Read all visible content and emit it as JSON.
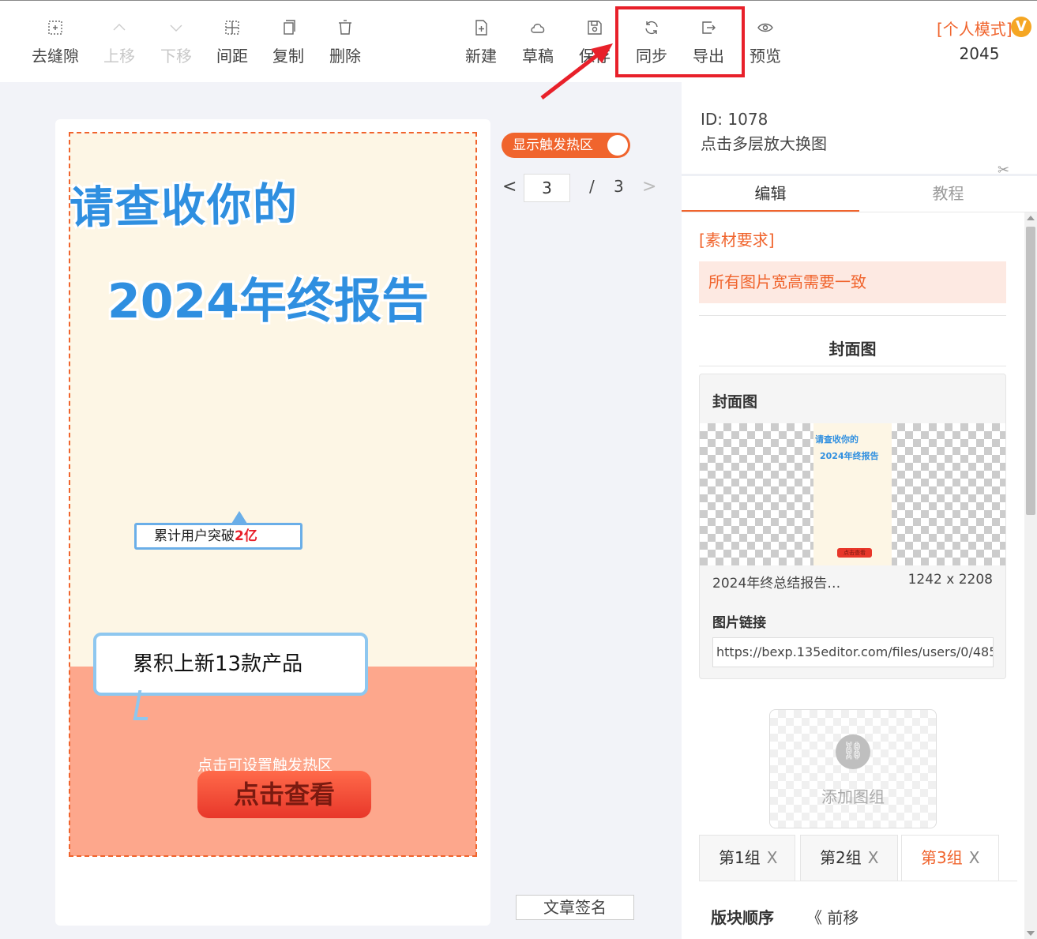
{
  "toolbar": {
    "items": [
      {
        "label": "去缝隙",
        "icon": "gap-icon",
        "enabled": true
      },
      {
        "label": "上移",
        "icon": "chevron-up-icon",
        "enabled": false
      },
      {
        "label": "下移",
        "icon": "chevron-down-icon",
        "enabled": false
      },
      {
        "label": "间距",
        "icon": "spacing-icon",
        "enabled": true
      },
      {
        "label": "复制",
        "icon": "copy-icon",
        "enabled": true
      },
      {
        "label": "删除",
        "icon": "trash-icon",
        "enabled": true
      },
      {
        "label": "新建",
        "icon": "new-file-icon",
        "enabled": true
      },
      {
        "label": "草稿",
        "icon": "cloud-icon",
        "enabled": true
      },
      {
        "label": "保存",
        "icon": "save-icon",
        "enabled": true
      },
      {
        "label": "同步",
        "icon": "sync-icon",
        "enabled": true
      },
      {
        "label": "导出",
        "icon": "export-icon",
        "enabled": true
      },
      {
        "label": "预览",
        "icon": "eye-icon",
        "enabled": true
      }
    ],
    "mode_label": "[个人模式]",
    "mode_number": "2045",
    "vip_badge": "V"
  },
  "canvas": {
    "toggle_label": "显示触发热区",
    "pager": {
      "current": "3",
      "separator": "/",
      "total": "3",
      "prev": "<",
      "next": ">"
    },
    "title_line1": "请查收你的",
    "title_line2": "2024年终报告",
    "bubble1_text": "累计用户突破",
    "bubble1_highlight": "2亿",
    "bubble2_text": "累积上新13款产品",
    "hotzone_label": "点击可设置触发热区",
    "cta_label": "点击查看",
    "sign_button": "文章签名"
  },
  "panel": {
    "id_line": "ID: 1078",
    "name_line": "点击多层放大换图",
    "tabs": [
      {
        "label": "编辑",
        "active": true
      },
      {
        "label": "教程",
        "active": false
      }
    ],
    "requirement_title": "[素材要求]",
    "requirement_text": "所有图片宽高需要一致",
    "section_title": "封面图",
    "cover": {
      "title": "封面图",
      "thumb_line1": "请查收你的",
      "thumb_line2": "2024年终报告",
      "thumb_button": "点击查看",
      "file_name": "2024年终总结报告…",
      "size": "1242 x 2208",
      "link_label": "图片链接",
      "link_value": "https://bexp.135editor.com/files/users/0/485..."
    },
    "add_group_label": "添加图组",
    "groups": [
      {
        "label": "第1组",
        "close": "X",
        "active": false
      },
      {
        "label": "第2组",
        "close": "X",
        "active": false
      },
      {
        "label": "第3组",
        "close": "X",
        "active": true
      }
    ],
    "order_label": "版块顺序",
    "forward_label": "《 前移"
  },
  "colors": {
    "accent": "#f0642d",
    "highlight_box": "#e8202a",
    "title_blue": "#2f8fe0",
    "hotzone": "#fd9173"
  }
}
